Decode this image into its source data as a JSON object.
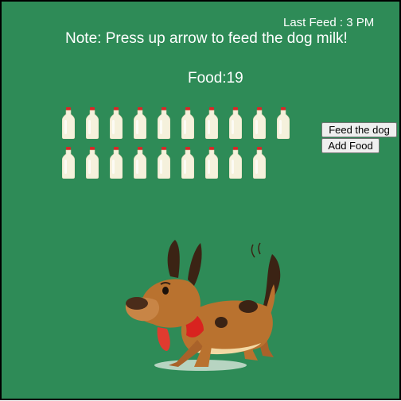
{
  "hud": {
    "last_feed": "Last Feed : 3 PM",
    "note": "Note: Press up arrow to feed the dog milk!",
    "food_label": "Food:19"
  },
  "buttons": {
    "feed": "Feed the dog",
    "add": "Add Food"
  },
  "milk": {
    "count": 19,
    "per_row": 10,
    "icon": "milk-bottle-icon"
  },
  "dog": {
    "icon": "dog-icon"
  },
  "colors": {
    "background": "#2e8b57",
    "text": "#ffffff",
    "bottle_cap": "#d62828",
    "milk": "#f5f1dc",
    "dog_body": "#b9722f",
    "collar": "#d9231f"
  }
}
